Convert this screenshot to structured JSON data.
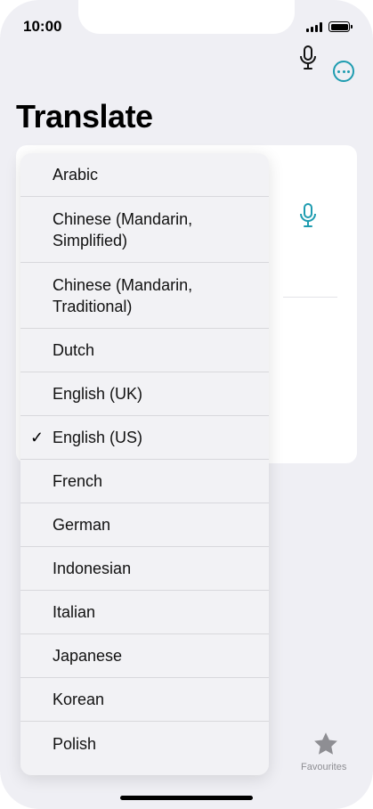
{
  "status_bar": {
    "time": "10:00"
  },
  "header": {
    "title": "Translate",
    "more_icon": "ellipsis-circle-icon"
  },
  "card": {
    "top_mic_icon": "microphone-icon",
    "bottom_mic_icon": "microphone-icon",
    "bottom_mic_color": "#1e9cb0"
  },
  "language_menu": {
    "selected": "English (US)",
    "options": [
      {
        "label": "Arabic"
      },
      {
        "label": "Chinese (Mandarin, Simplified)"
      },
      {
        "label": "Chinese (Mandarin, Traditional)"
      },
      {
        "label": "Dutch"
      },
      {
        "label": "English (UK)"
      },
      {
        "label": "English (US)",
        "checkmark": "✓"
      },
      {
        "label": "French"
      },
      {
        "label": "German"
      },
      {
        "label": "Indonesian"
      },
      {
        "label": "Italian"
      },
      {
        "label": "Japanese"
      },
      {
        "label": "Korean"
      },
      {
        "label": "Polish"
      }
    ]
  },
  "tab_bar": {
    "favourites_label": "Favourites",
    "favourites_icon": "star-icon"
  },
  "colors": {
    "accent": "#1e9cb0",
    "background": "#efeff4"
  }
}
